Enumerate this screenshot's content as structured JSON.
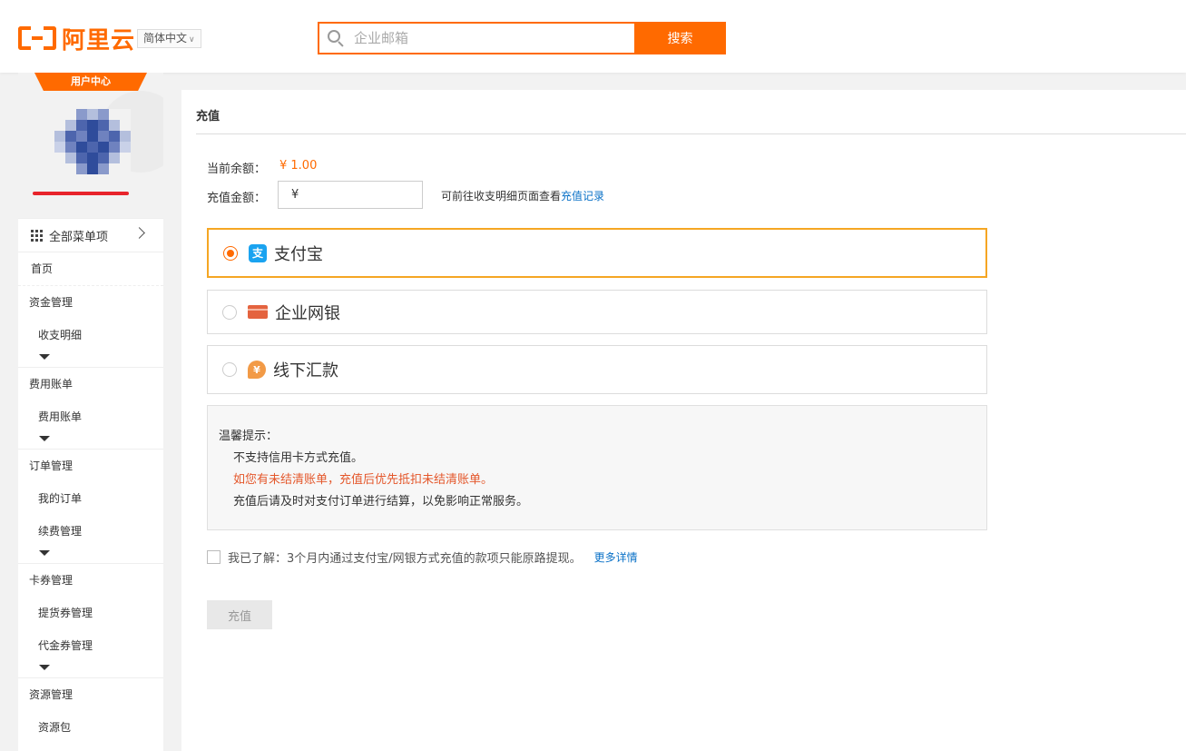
{
  "header": {
    "logo_text": "阿里云",
    "language": "简体中文",
    "search": {
      "placeholder": "企业邮箱",
      "button": "搜索"
    }
  },
  "sidebar": {
    "badge": "用户中心",
    "all_menu": "全部菜单项",
    "home": "首页",
    "groups": [
      {
        "title": "资金管理",
        "items": [
          "收支明细"
        ]
      },
      {
        "title": "费用账单",
        "items": [
          "费用账单"
        ]
      },
      {
        "title": "订单管理",
        "items": [
          "我的订单",
          "续费管理"
        ]
      },
      {
        "title": "卡券管理",
        "items": [
          "提货券管理",
          "代金券管理"
        ]
      },
      {
        "title": "资源管理",
        "items": [
          "资源包"
        ]
      }
    ]
  },
  "main": {
    "title": "充值",
    "balance_label": "当前余额：",
    "balance_value": "¥ 1.00",
    "amount_label": "充值金额：",
    "amount_prefix": "¥",
    "hint_text": "可前往收支明细页面查看",
    "hint_link": "充值记录",
    "payment_methods": [
      {
        "label": "支付宝",
        "icon": "alipay-icon",
        "selected": true
      },
      {
        "label": "企业网银",
        "icon": "bank-card-icon",
        "selected": false
      },
      {
        "label": "线下汇款",
        "icon": "offline-remit-icon",
        "selected": false
      }
    ],
    "tips": {
      "title": "温馨提示：",
      "line1": "不支持信用卡方式充值。",
      "line2": "如您有未结清账单，充值后优先抵扣未结清账单。",
      "line3": "充值后请及时对支付订单进行结算，以免影响正常服务。"
    },
    "agree_text": "我已了解：3个月内通过支付宝/网银方式充值的款项只能原路提现。",
    "agree_link": "更多详情",
    "submit": "充值"
  },
  "colors": {
    "accent": "#ff6a00",
    "link": "#0a71c7",
    "warning": "#e4572b",
    "selected_border": "#f5a623"
  }
}
